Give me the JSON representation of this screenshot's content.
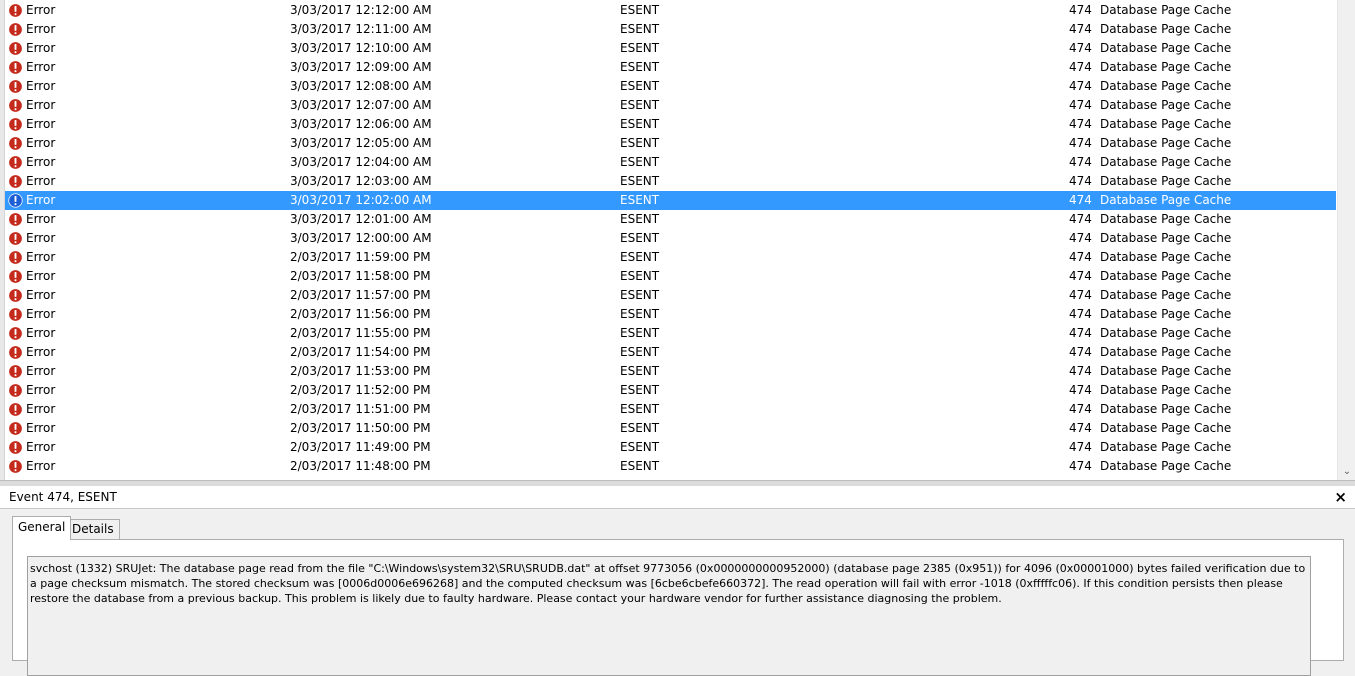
{
  "events": [
    {
      "level": "Error",
      "date": "3/03/2017 12:12:00 AM",
      "source": "ESENT",
      "event_id": "474",
      "task": "Database Page Cache"
    },
    {
      "level": "Error",
      "date": "3/03/2017 12:11:00 AM",
      "source": "ESENT",
      "event_id": "474",
      "task": "Database Page Cache"
    },
    {
      "level": "Error",
      "date": "3/03/2017 12:10:00 AM",
      "source": "ESENT",
      "event_id": "474",
      "task": "Database Page Cache"
    },
    {
      "level": "Error",
      "date": "3/03/2017 12:09:00 AM",
      "source": "ESENT",
      "event_id": "474",
      "task": "Database Page Cache"
    },
    {
      "level": "Error",
      "date": "3/03/2017 12:08:00 AM",
      "source": "ESENT",
      "event_id": "474",
      "task": "Database Page Cache"
    },
    {
      "level": "Error",
      "date": "3/03/2017 12:07:00 AM",
      "source": "ESENT",
      "event_id": "474",
      "task": "Database Page Cache"
    },
    {
      "level": "Error",
      "date": "3/03/2017 12:06:00 AM",
      "source": "ESENT",
      "event_id": "474",
      "task": "Database Page Cache"
    },
    {
      "level": "Error",
      "date": "3/03/2017 12:05:00 AM",
      "source": "ESENT",
      "event_id": "474",
      "task": "Database Page Cache"
    },
    {
      "level": "Error",
      "date": "3/03/2017 12:04:00 AM",
      "source": "ESENT",
      "event_id": "474",
      "task": "Database Page Cache"
    },
    {
      "level": "Error",
      "date": "3/03/2017 12:03:00 AM",
      "source": "ESENT",
      "event_id": "474",
      "task": "Database Page Cache"
    },
    {
      "level": "Error",
      "date": "3/03/2017 12:02:00 AM",
      "source": "ESENT",
      "event_id": "474",
      "task": "Database Page Cache",
      "selected": true
    },
    {
      "level": "Error",
      "date": "3/03/2017 12:01:00 AM",
      "source": "ESENT",
      "event_id": "474",
      "task": "Database Page Cache"
    },
    {
      "level": "Error",
      "date": "3/03/2017 12:00:00 AM",
      "source": "ESENT",
      "event_id": "474",
      "task": "Database Page Cache"
    },
    {
      "level": "Error",
      "date": "2/03/2017 11:59:00 PM",
      "source": "ESENT",
      "event_id": "474",
      "task": "Database Page Cache"
    },
    {
      "level": "Error",
      "date": "2/03/2017 11:58:00 PM",
      "source": "ESENT",
      "event_id": "474",
      "task": "Database Page Cache"
    },
    {
      "level": "Error",
      "date": "2/03/2017 11:57:00 PM",
      "source": "ESENT",
      "event_id": "474",
      "task": "Database Page Cache"
    },
    {
      "level": "Error",
      "date": "2/03/2017 11:56:00 PM",
      "source": "ESENT",
      "event_id": "474",
      "task": "Database Page Cache"
    },
    {
      "level": "Error",
      "date": "2/03/2017 11:55:00 PM",
      "source": "ESENT",
      "event_id": "474",
      "task": "Database Page Cache"
    },
    {
      "level": "Error",
      "date": "2/03/2017 11:54:00 PM",
      "source": "ESENT",
      "event_id": "474",
      "task": "Database Page Cache"
    },
    {
      "level": "Error",
      "date": "2/03/2017 11:53:00 PM",
      "source": "ESENT",
      "event_id": "474",
      "task": "Database Page Cache"
    },
    {
      "level": "Error",
      "date": "2/03/2017 11:52:00 PM",
      "source": "ESENT",
      "event_id": "474",
      "task": "Database Page Cache"
    },
    {
      "level": "Error",
      "date": "2/03/2017 11:51:00 PM",
      "source": "ESENT",
      "event_id": "474",
      "task": "Database Page Cache"
    },
    {
      "level": "Error",
      "date": "2/03/2017 11:50:00 PM",
      "source": "ESENT",
      "event_id": "474",
      "task": "Database Page Cache"
    },
    {
      "level": "Error",
      "date": "2/03/2017 11:49:00 PM",
      "source": "ESENT",
      "event_id": "474",
      "task": "Database Page Cache"
    },
    {
      "level": "Error",
      "date": "2/03/2017 11:48:00 PM",
      "source": "ESENT",
      "event_id": "474",
      "task": "Database Page Cache"
    }
  ],
  "icons": {
    "error": "error-icon",
    "scroll_down": "scroll-down-arrow-icon",
    "close": "close-icon"
  },
  "colors": {
    "selection": "#3399ff",
    "error_red": "#c42b1c",
    "info_blue": "#1e5fd6"
  },
  "detail": {
    "title": "Event 474, ESENT",
    "close_glyph": "×",
    "tabs": [
      {
        "label": "General",
        "active": true
      },
      {
        "label": "Details",
        "active": false
      }
    ],
    "description": "svchost (1332) SRUJet: The database page read from the file \"C:\\Windows\\system32\\SRU\\SRUDB.dat\" at offset 9773056 (0x0000000000952000) (database page 2385 (0x951)) for 4096 (0x00001000) bytes failed verification due to a page checksum mismatch.  The stored checksum was [0006d0006e696268] and the computed checksum was [6cbe6cbefe660372].  The read operation will fail with error -1018 (0xfffffc06).  If this condition persists then please restore the database from a previous backup.  This problem is likely due to faulty hardware. Please contact your hardware vendor for further assistance diagnosing the problem."
  }
}
